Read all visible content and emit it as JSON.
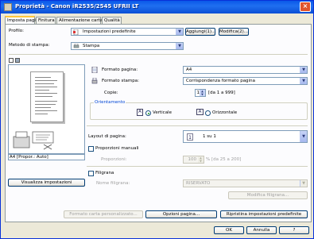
{
  "window": {
    "title": "Proprietà - Canon iR2535/2545 UFRII LT",
    "close_label": "×"
  },
  "tabs": [
    {
      "label": "Imposta pagina"
    },
    {
      "label": "Finitura"
    },
    {
      "label": "Alimentazione carta"
    },
    {
      "label": "Qualità"
    }
  ],
  "profile": {
    "label": "Profilo:",
    "value": "Impostazioni predefinite",
    "add_button": "Aggiungi(1)...",
    "edit_button": "Modifica(2)..."
  },
  "output_method": {
    "label": "Metodo di stampa:",
    "value": "Stampa"
  },
  "preview": {
    "status": "A4 [Propor.: Auto]",
    "view_settings_button": "Visualizza impostazioni"
  },
  "page_size": {
    "label": "Formato pagina:",
    "value": "A4"
  },
  "output_size": {
    "label": "Formato stampa:",
    "value": "Corrispondenza formato pagina"
  },
  "copies": {
    "label": "Copie:",
    "value": "1",
    "range": "[da 1 a 999]"
  },
  "orientation": {
    "label": "Orientamento",
    "portrait_label": "Verticale",
    "landscape_label": "Orizzontale",
    "selected": "portrait"
  },
  "page_layout": {
    "label": "Layout di pagina:",
    "value": "1 su 1"
  },
  "manual_scaling": {
    "label": "Proporzioni manuali",
    "scale_label": "Proporzioni:",
    "value": "100",
    "range": "% [da 25 a 200]"
  },
  "watermark": {
    "label": "Filigrana",
    "name_label": "Nome filigrana:",
    "value": "RISERVATO",
    "edit_button": "Modifica filigrana..."
  },
  "bottom_buttons": {
    "custom_paper": "Formato carta personalizzato...",
    "page_options": "Opzioni pagina...",
    "restore_defaults": "Ripristina impostazioni predefinite"
  },
  "dialog_buttons": {
    "ok": "OK",
    "cancel": "Annulla",
    "help": "?"
  }
}
